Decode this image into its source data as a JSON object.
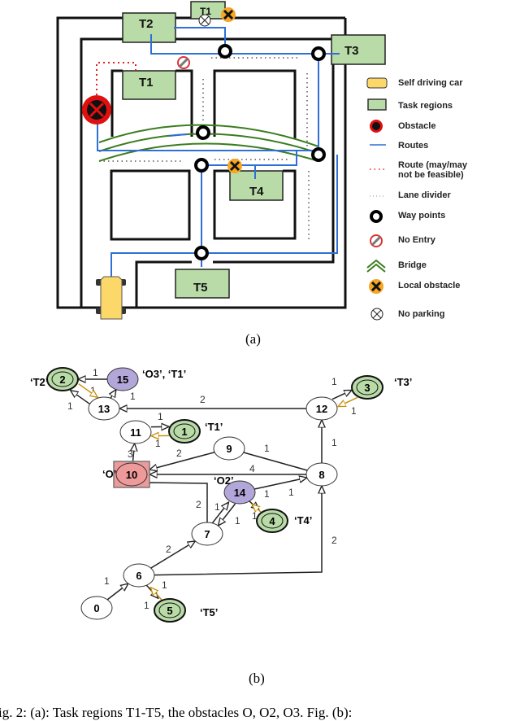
{
  "figure_a": {
    "caption": "(a)",
    "task_labels": {
      "t1_top": "T1",
      "t2": "T2",
      "t3": "T3",
      "t1": "T1",
      "t4": "T4",
      "t5": "T5"
    },
    "colors": {
      "route": "#2f6fd6",
      "task": "#b9dba8",
      "bridge": "#3b7d1f",
      "obstacle": "#e01010",
      "local_obstacle": "#f5a623",
      "car": "#fcd86a",
      "infeasible_route": "#e02020"
    },
    "legend": [
      {
        "icon": "car-icon",
        "label": "Self driving car"
      },
      {
        "icon": "task-region-icon",
        "label": "Task regions"
      },
      {
        "icon": "obstacle-icon",
        "label": "Obstacle"
      },
      {
        "icon": "route-line-icon",
        "label": "Routes"
      },
      {
        "icon": "dotted-route-icon",
        "label": "Route (may/may not be feasible)"
      },
      {
        "icon": "lane-divider-icon",
        "label": "Lane divider"
      },
      {
        "icon": "waypoint-icon",
        "label": "Way points"
      },
      {
        "icon": "no-entry-icon",
        "label": "No Entry"
      },
      {
        "icon": "bridge-icon",
        "label": "Bridge"
      },
      {
        "icon": "local-obstacle-icon",
        "label": "Local obstacle"
      },
      {
        "icon": "no-parking-icon",
        "label": "No parking"
      }
    ]
  },
  "figure_b": {
    "caption": "(b)",
    "colors": {
      "task": "#b9dba8",
      "obstacle_node": "#b3a6d9",
      "blocked_node": "#ee9a9a",
      "default": "#ffffff",
      "return_edge": "#c8900a",
      "edge": "#222222"
    },
    "nodes": [
      {
        "id": "0",
        "kind": "default"
      },
      {
        "id": "1",
        "kind": "task"
      },
      {
        "id": "2",
        "kind": "task"
      },
      {
        "id": "3",
        "kind": "task"
      },
      {
        "id": "4",
        "kind": "task"
      },
      {
        "id": "5",
        "kind": "task"
      },
      {
        "id": "6",
        "kind": "default"
      },
      {
        "id": "7",
        "kind": "default"
      },
      {
        "id": "8",
        "kind": "default"
      },
      {
        "id": "9",
        "kind": "default"
      },
      {
        "id": "10",
        "kind": "blocked"
      },
      {
        "id": "11",
        "kind": "default"
      },
      {
        "id": "12",
        "kind": "default"
      },
      {
        "id": "13",
        "kind": "default"
      },
      {
        "id": "14",
        "kind": "obstacle"
      },
      {
        "id": "15",
        "kind": "obstacle"
      }
    ],
    "node_labels": [
      {
        "node": "2",
        "text": "‘T2’"
      },
      {
        "node": "15",
        "text": "‘O3’, ‘T1’"
      },
      {
        "node": "3",
        "text": "‘T3’"
      },
      {
        "node": "1",
        "text": "‘T1’"
      },
      {
        "node": "10",
        "text": "‘O’"
      },
      {
        "node": "14",
        "text": "‘O2’"
      },
      {
        "node": "4",
        "text": "‘T4’"
      },
      {
        "node": "5",
        "text": "‘T5’"
      }
    ],
    "edges": [
      {
        "from": "15",
        "to": "2",
        "weight": "1"
      },
      {
        "from": "13",
        "to": "2",
        "weight": "1"
      },
      {
        "from": "13",
        "to": "15",
        "weight": "1"
      },
      {
        "from": "2",
        "to": "13",
        "weight": "1",
        "return": true
      },
      {
        "from": "12",
        "to": "13",
        "weight": "2"
      },
      {
        "from": "12",
        "to": "3",
        "weight": "1"
      },
      {
        "from": "3",
        "to": "12",
        "weight": "1",
        "return": true
      },
      {
        "from": "11",
        "to": "1",
        "weight": "1"
      },
      {
        "from": "1",
        "to": "11",
        "weight": "1",
        "return": true
      },
      {
        "from": "10",
        "to": "11",
        "weight": "3"
      },
      {
        "from": "9",
        "to": "10",
        "weight": "2"
      },
      {
        "from": "8",
        "to": "9",
        "weight": "1",
        "undirected": true
      },
      {
        "from": "8",
        "to": "10",
        "weight": "4"
      },
      {
        "from": "7",
        "to": "10",
        "weight": "2"
      },
      {
        "from": "14",
        "to": "8",
        "weight": "1"
      },
      {
        "from": "7",
        "to": "14",
        "weight": "1"
      },
      {
        "from": "14",
        "to": "7",
        "weight": "1"
      },
      {
        "from": "14",
        "to": "4",
        "weight": "1"
      },
      {
        "from": "4",
        "to": "14",
        "weight": "1",
        "return": true
      },
      {
        "from": "8",
        "to": "12",
        "weight": "1"
      },
      {
        "from": "6",
        "to": "7",
        "weight": "2"
      },
      {
        "from": "6",
        "to": "8",
        "weight": "2"
      },
      {
        "from": "0",
        "to": "6",
        "weight": "1"
      },
      {
        "from": "6",
        "to": "5",
        "weight": "1"
      },
      {
        "from": "5",
        "to": "6",
        "weight": "1",
        "return": true
      }
    ]
  },
  "caption_text": "ig. 2: (a): Task regions T1-T5, the obstacles O, O2, O3. Fig. (b):"
}
